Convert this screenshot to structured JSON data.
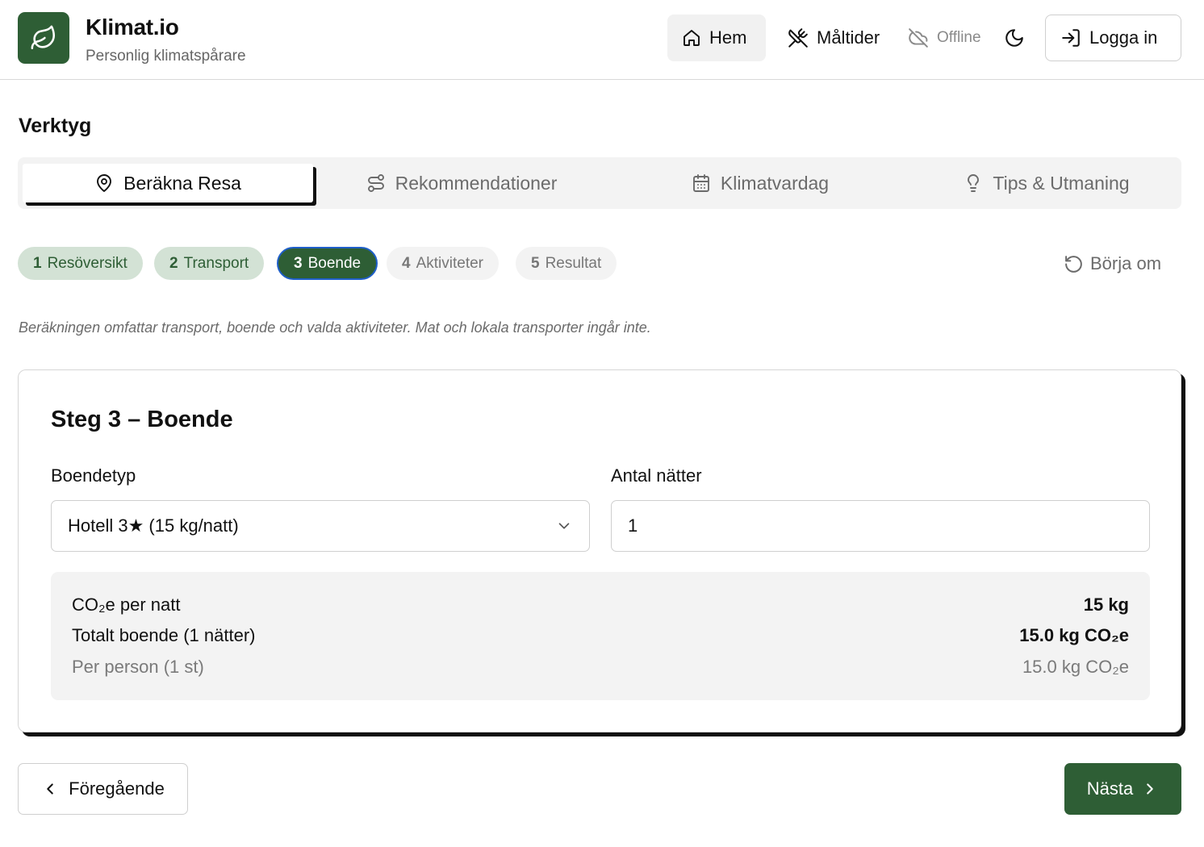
{
  "header": {
    "title": "Klimat.io",
    "subtitle": "Personlig klimatspårare",
    "logo_icon": "leaf-icon",
    "nav": {
      "home": "Hem",
      "meals": "Måltider",
      "offline": "Offline",
      "login": "Logga in"
    }
  },
  "section_title": "Verktyg",
  "tabs": [
    {
      "label": "Beräkna Resa",
      "icon": "map-pin-icon",
      "active": true
    },
    {
      "label": "Rekommendationer",
      "icon": "route-icon",
      "active": false
    },
    {
      "label": "Klimatvardag",
      "icon": "calendar-icon",
      "active": false
    },
    {
      "label": "Tips & Utmaning",
      "icon": "lightbulb-icon",
      "active": false
    }
  ],
  "steps": [
    {
      "num": "1",
      "label": "Resöversikt",
      "state": "done"
    },
    {
      "num": "2",
      "label": "Transport",
      "state": "done"
    },
    {
      "num": "3",
      "label": "Boende",
      "state": "current"
    },
    {
      "num": "4",
      "label": "Aktiviteter",
      "state": "todo"
    },
    {
      "num": "5",
      "label": "Resultat",
      "state": "todo"
    }
  ],
  "restart_label": "Börja om",
  "note": "Beräkningen omfattar transport, boende och valda aktiviteter. Mat och lokala transporter ingår inte.",
  "card": {
    "title": "Steg 3 – Boende",
    "type_label": "Boendetyp",
    "type_value": "Hotell 3★ (15 kg/natt)",
    "nights_label": "Antal nätter",
    "nights_value": "1",
    "summary": {
      "per_night_label": "CO₂e per natt",
      "per_night_value": "15 kg",
      "total_label": "Totalt boende (1 nätter)",
      "total_value": "15.0 kg CO₂e",
      "per_person_label": "Per person (1 st)",
      "per_person_value": "15.0 kg CO₂e"
    }
  },
  "buttons": {
    "prev": "Föregående",
    "next": "Nästa"
  },
  "colors": {
    "brand_green": "#2e5e35",
    "step_done_bg": "#d3e2d5",
    "focus_ring": "#1f5fc9"
  }
}
